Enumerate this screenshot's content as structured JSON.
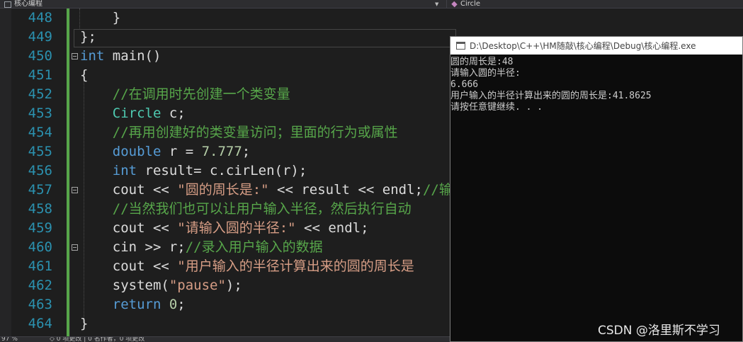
{
  "navbar": {
    "scope": "核心编程",
    "member": "Circle"
  },
  "editor": {
    "lines": [
      {
        "num": "448",
        "parts": [
          {
            "cls": "pl",
            "text": "    }"
          }
        ]
      },
      {
        "num": "449",
        "parts": [
          {
            "cls": "pl",
            "text": "};"
          }
        ]
      },
      {
        "num": "450",
        "parts": [
          {
            "cls": "kw",
            "text": "int"
          },
          {
            "cls": "pl",
            "text": " main()"
          }
        ]
      },
      {
        "num": "451",
        "parts": [
          {
            "cls": "pl",
            "text": "{"
          }
        ]
      },
      {
        "num": "452",
        "parts": [
          {
            "cls": "cm",
            "text": "    //在调用时先创建一个类变量"
          }
        ]
      },
      {
        "num": "453",
        "parts": [
          {
            "cls": "ty",
            "text": "    Circle"
          },
          {
            "cls": "pl",
            "text": " c;"
          }
        ]
      },
      {
        "num": "454",
        "parts": [
          {
            "cls": "cm",
            "text": "    //再用创建好的类变量访问；里面的行为或属性"
          }
        ]
      },
      {
        "num": "455",
        "parts": [
          {
            "cls": "kw",
            "text": "    double"
          },
          {
            "cls": "pl",
            "text": " r = "
          },
          {
            "cls": "nu",
            "text": "7.777"
          },
          {
            "cls": "pl",
            "text": ";"
          }
        ]
      },
      {
        "num": "456",
        "parts": [
          {
            "cls": "kw",
            "text": "    int"
          },
          {
            "cls": "pl",
            "text": " result= c.cirLen(r);"
          }
        ]
      },
      {
        "num": "457",
        "parts": [
          {
            "cls": "pl",
            "text": "    cout << "
          },
          {
            "cls": "st",
            "text": "\"圆的周长是:\""
          },
          {
            "cls": "pl",
            "text": " << result << endl;"
          },
          {
            "cls": "cm",
            "text": "//输"
          }
        ]
      },
      {
        "num": "458",
        "parts": [
          {
            "cls": "cm",
            "text": "    //当然我们也可以让用户输入半径，然后执行自动"
          }
        ]
      },
      {
        "num": "459",
        "parts": [
          {
            "cls": "pl",
            "text": "    cout << "
          },
          {
            "cls": "st",
            "text": "\"请输入圆的半径:\""
          },
          {
            "cls": "pl",
            "text": " << endl;"
          }
        ]
      },
      {
        "num": "460",
        "parts": [
          {
            "cls": "pl",
            "text": "    cin >> r;"
          },
          {
            "cls": "cm",
            "text": "//录入用户输入的数据"
          }
        ]
      },
      {
        "num": "461",
        "parts": [
          {
            "cls": "pl",
            "text": "    cout << "
          },
          {
            "cls": "st",
            "text": "\"用户输入的半径计算出来的圆的周长是"
          }
        ]
      },
      {
        "num": "462",
        "parts": [
          {
            "cls": "pl",
            "text": "    system("
          },
          {
            "cls": "st",
            "text": "\"pause\""
          },
          {
            "cls": "pl",
            "text": ");"
          }
        ]
      },
      {
        "num": "463",
        "parts": [
          {
            "cls": "kw",
            "text": "    return"
          },
          {
            "cls": "pl",
            "text": " "
          },
          {
            "cls": "nu",
            "text": "0"
          },
          {
            "cls": "pl",
            "text": ";"
          }
        ]
      },
      {
        "num": "464",
        "parts": [
          {
            "cls": "pl",
            "text": "}"
          }
        ]
      }
    ]
  },
  "statusbar": {
    "zoom": "97 %",
    "info": "◇ 0 项更改 | 0 名作者，0 项更改"
  },
  "console": {
    "title": "D:\\Desktop\\C++\\HM随敲\\核心编程\\Debug\\核心编程.exe",
    "lines": [
      "圆的周长是:48",
      "请输入圆的半径:",
      "6.666",
      "用户输入的半径计算出来的圆的周长是:41.8625",
      "请按任意键继续. . ."
    ]
  },
  "watermark": "CSDN @洛里斯不学习"
}
